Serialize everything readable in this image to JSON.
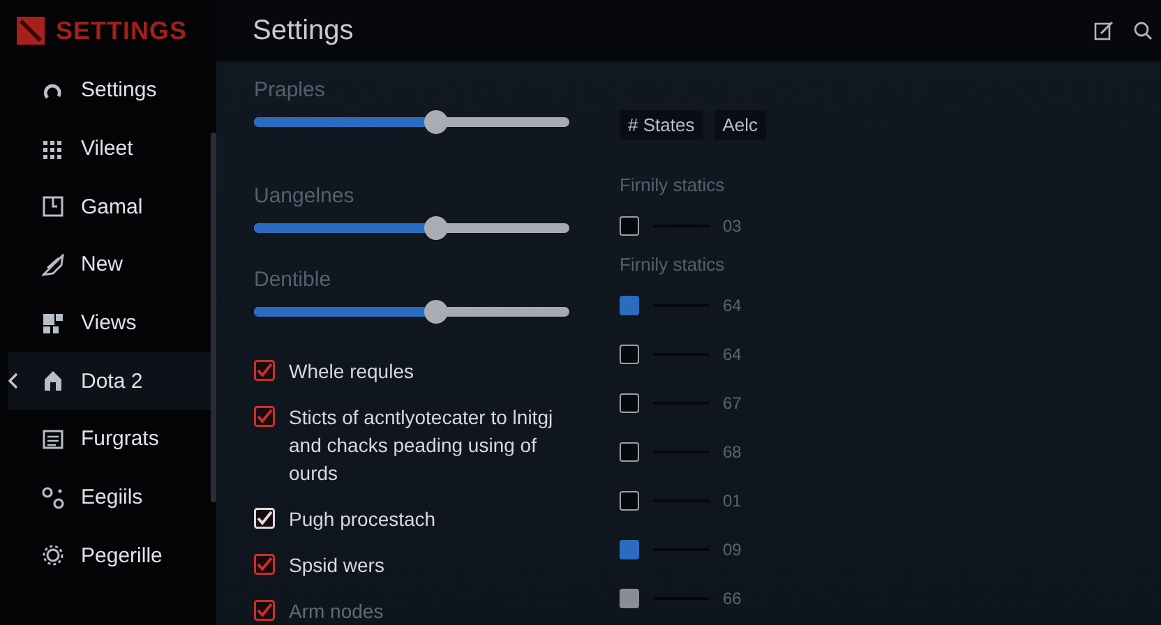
{
  "app": {
    "logo_text": "SETTINGS"
  },
  "sidebar": {
    "items": [
      {
        "label": "Settings",
        "selected": false
      },
      {
        "label": "Vileet",
        "selected": false
      },
      {
        "label": "Gamal",
        "selected": false
      },
      {
        "label": "New",
        "selected": false
      },
      {
        "label": "Views",
        "selected": false
      },
      {
        "label": "Dota 2",
        "selected": true
      },
      {
        "label": "Furgrats",
        "selected": false
      },
      {
        "label": "Eegiils",
        "selected": false
      },
      {
        "label": "Pegerille",
        "selected": false
      }
    ]
  },
  "header": {
    "title": "Settings"
  },
  "sliders": [
    {
      "label": "Praples",
      "level": 0.58
    },
    {
      "label": "Uangelnes",
      "level": 0.58
    },
    {
      "label": "Dentible",
      "level": 0.58
    }
  ],
  "chips": [
    "# States",
    "Aelc"
  ],
  "checkboxes": [
    {
      "label": "Whele requles",
      "checked": true,
      "color": "#c8302c"
    },
    {
      "label": "Sticts of acntlyotecater to lnitgj and chacks peading using of ourds",
      "checked": true,
      "color": "#c8302c"
    },
    {
      "label": "Pugh procestach",
      "checked": true,
      "color": "#d8dce0"
    },
    {
      "label": "Spsid wers",
      "checked": true,
      "color": "#c8302c"
    },
    {
      "label": "Arm nodes",
      "checked": true,
      "color": "#c8302c",
      "disabled": true
    }
  ],
  "options": [
    {
      "kind": "header",
      "label": "Firnily statics"
    },
    {
      "kind": "check",
      "checked": false,
      "disabled": false,
      "value": "03"
    },
    {
      "kind": "header",
      "label": "Firnily statics"
    },
    {
      "kind": "check",
      "checked": true,
      "disabled": false,
      "value": "64"
    },
    {
      "kind": "check",
      "checked": false,
      "disabled": false,
      "value": "64"
    },
    {
      "kind": "check",
      "checked": false,
      "disabled": false,
      "value": "67"
    },
    {
      "kind": "check",
      "checked": false,
      "disabled": false,
      "value": "68"
    },
    {
      "kind": "check",
      "checked": false,
      "disabled": false,
      "value": "01"
    },
    {
      "kind": "check",
      "checked": true,
      "disabled": false,
      "value": "09"
    },
    {
      "kind": "check",
      "checked": false,
      "disabled": true,
      "value": "66"
    }
  ]
}
